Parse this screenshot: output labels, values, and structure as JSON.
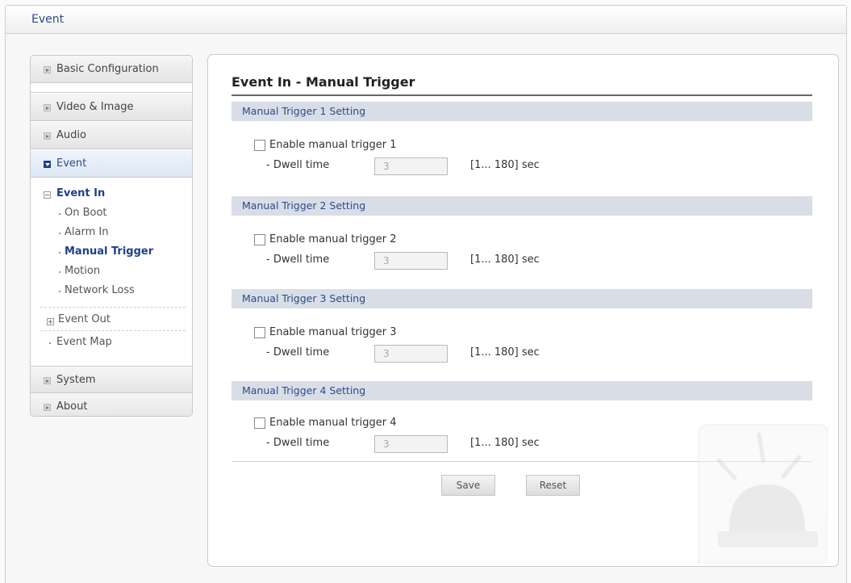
{
  "window": {
    "title": "Event"
  },
  "sidebar": {
    "basic_config": "Basic Configuration",
    "video_image": "Video & Image",
    "audio": "Audio",
    "event": "Event",
    "event_in": "Event In",
    "on_boot": "On Boot",
    "alarm_in": "Alarm In",
    "manual_trigger": "Manual Trigger",
    "motion": "Motion",
    "network_loss": "Network Loss",
    "event_out": "Event Out",
    "event_map": "Event Map",
    "system": "System",
    "about": "About"
  },
  "main": {
    "title": "Event In - Manual Trigger",
    "sections": [
      {
        "header": "Manual Trigger 1 Setting",
        "checkbox_label": "Enable manual trigger 1",
        "checked": false,
        "dwell_label": "- Dwell time",
        "dwell_value": "3",
        "range": "[1... 180] sec"
      },
      {
        "header": "Manual Trigger 2 Setting",
        "checkbox_label": "Enable manual trigger 2",
        "checked": false,
        "dwell_label": "- Dwell time",
        "dwell_value": "3",
        "range": "[1... 180] sec"
      },
      {
        "header": "Manual Trigger 3 Setting",
        "checkbox_label": "Enable manual trigger 3",
        "checked": false,
        "dwell_label": "- Dwell time",
        "dwell_value": "3",
        "range": "[1... 180] sec"
      },
      {
        "header": "Manual Trigger 4 Setting",
        "checkbox_label": "Enable manual trigger 4",
        "checked": false,
        "dwell_label": "- Dwell time",
        "dwell_value": "3",
        "range": "[1... 180] sec"
      }
    ],
    "save_label": "Save",
    "reset_label": "Reset"
  },
  "icons": {
    "watermark": "alarm-light-icon"
  },
  "colors": {
    "accent": "#2a4c8c",
    "section_bg": "#d9dde6"
  }
}
